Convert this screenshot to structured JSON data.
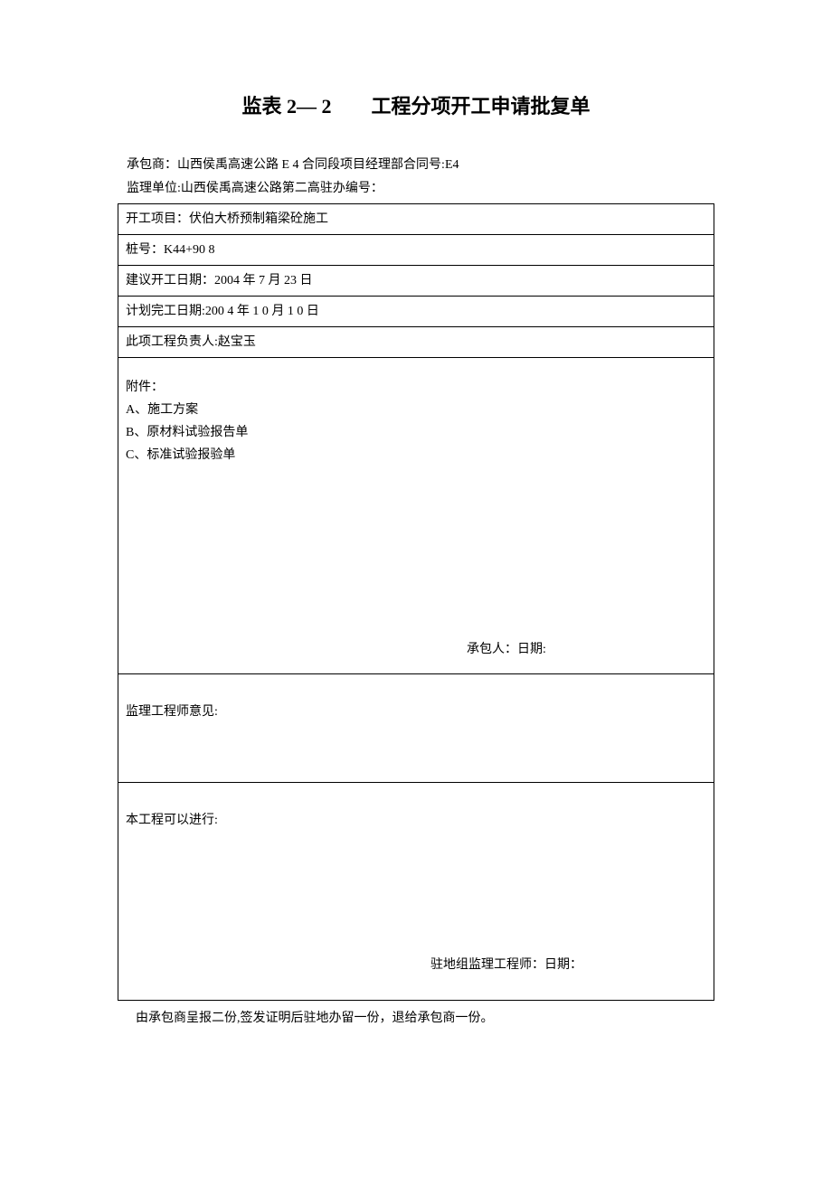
{
  "title": "监表 2— 2　　工程分项开工申请批复单",
  "header": {
    "contractor_line": "承包商：山西侯禹高速公路 E 4 合同段项目经理部合同号:E4",
    "supervisor_line": "监理单位:山西侯禹高速公路第二高驻办编号："
  },
  "rows": {
    "project": "开工项目：伏伯大桥预制箱梁砼施工",
    "pile_no": "桩号：K44+90 8",
    "suggested_start": "建议开工日期：2004 年 7 月 23 日",
    "planned_end": "计划完工日期:200 4 年 1 0 月 1 0 日",
    "responsible": "此项工程负责人:赵宝玉"
  },
  "attachments": {
    "label": "附件：",
    "items": [
      "A、施工方案",
      "B、原材料试验报告单",
      "C、标准试验报验单"
    ],
    "contractor_sign": "承包人：日期:"
  },
  "supervisor_opinion": "监理工程师意见:",
  "proceed": {
    "label": "本工程可以进行:",
    "engineer_sign": "驻地组监理工程师：日期："
  },
  "footer": "由承包商呈报二份,签发证明后驻地办留一份，退给承包商一份。"
}
